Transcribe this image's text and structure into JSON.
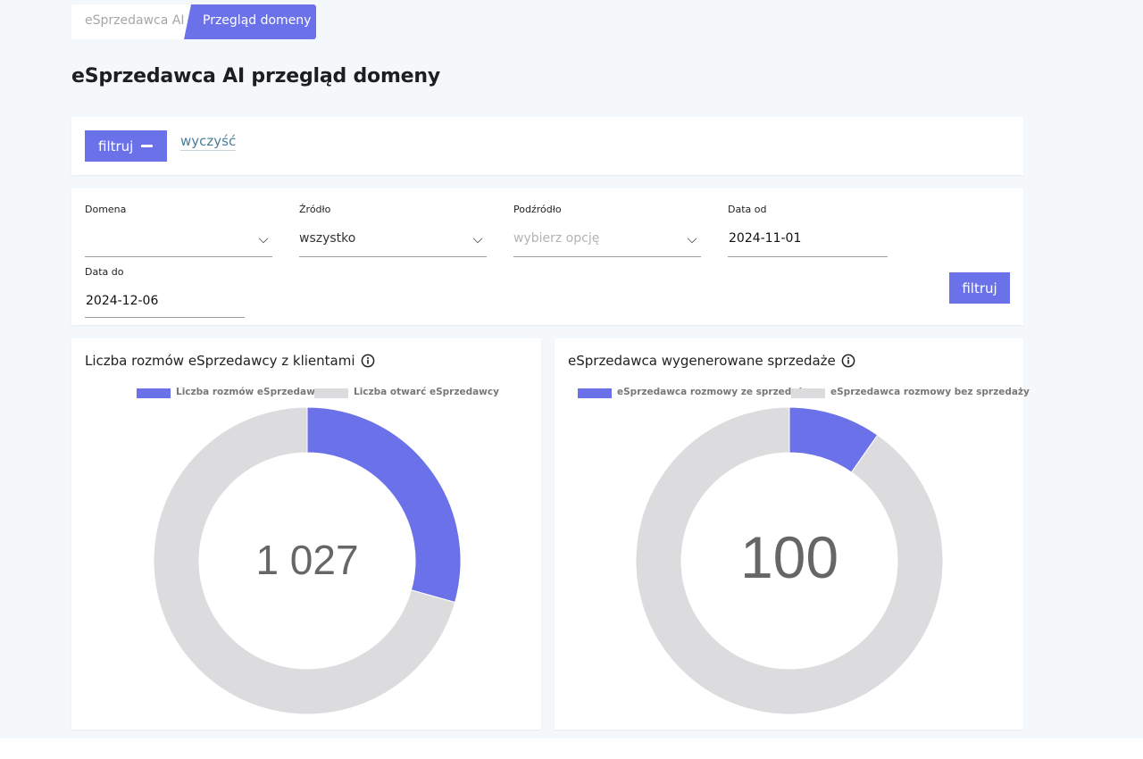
{
  "breadcrumb": {
    "items": [
      "eSprzedawca AI",
      "Przegląd domeny"
    ]
  },
  "page_title": "eSprzedawca AI przegląd domeny",
  "toggle": {
    "filter_label": "filtruj",
    "clear_label": "wyczyść"
  },
  "filters": {
    "domena": {
      "label": "Domena",
      "value": ""
    },
    "zrodlo": {
      "label": "Źródło",
      "value": "wszystko"
    },
    "podzrodlo": {
      "label": "Podźródło",
      "placeholder": "wybierz opcję"
    },
    "data_od": {
      "label": "Data od",
      "value": "2024-11-01"
    },
    "data_do": {
      "label": "Data do",
      "value": "2024-12-06"
    },
    "submit_label": "filtruj"
  },
  "colors": {
    "accent": "#6b72e9",
    "inactive": "#dcdbdd",
    "background": "#f4f8fb"
  },
  "charts": [
    {
      "title": "Liczba rozmów eSprzedawcy z klientami",
      "center_value": "1 027",
      "legend": [
        "Liczba rozmów eSprzedawcy",
        "Liczba otwarć eSprzedawcy"
      ]
    },
    {
      "title": "eSprzedawca wygenerowane sprzedaże",
      "center_value": "100",
      "legend": [
        "eSprzedawca rozmowy ze sprzedażą",
        "eSprzedawca rozmowy bez sprzedaży"
      ]
    }
  ],
  "chart_data": [
    {
      "type": "pie",
      "categories": [
        "Liczba rozmów eSprzedawcy",
        "Liczba otwarć eSprzedawcy"
      ],
      "values": [
        1027,
        2470
      ],
      "colors": [
        "#6b72e9",
        "#dcdbdd"
      ],
      "title": "Liczba rozmów eSprzedawcy z klientami",
      "legend_position": "top"
    },
    {
      "type": "pie",
      "categories": [
        "eSprzedawca rozmowy ze sprzedażą",
        "eSprzedawca rozmowy bez sprzedaży"
      ],
      "values": [
        100,
        927
      ],
      "colors": [
        "#6b72e9",
        "#dcdbdd"
      ],
      "title": "eSprzedawca wygenerowane sprzedaże",
      "legend_position": "top"
    }
  ]
}
